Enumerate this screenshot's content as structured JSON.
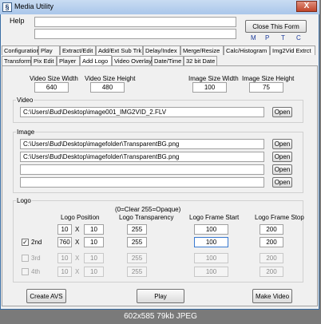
{
  "window": {
    "title": "Media Utility",
    "close_glyph": "X"
  },
  "menu": {
    "help": "Help"
  },
  "top": {
    "close_form": "Close This Form",
    "flags": [
      "M",
      "P",
      "T",
      "C"
    ]
  },
  "tabs_row1": [
    "Configuration",
    "Play",
    "Extract/Edit",
    "Add/Ext Sub Trk",
    "Delay/Index",
    "Merge/Resize",
    "Calc/Histogram",
    "Img2Vid Extrct"
  ],
  "tabs_row2": [
    "Transform",
    "Pix Edit",
    "Player",
    "Add Logo",
    "Video Overlay",
    "Date/Time",
    "32 bit Date"
  ],
  "sizes": {
    "video_width_label": "Video Size Width",
    "video_width": "640",
    "video_height_label": "Video Size Height",
    "video_height": "480",
    "image_width_label": "Image Size Width",
    "image_width": "100",
    "image_height_label": "Image Size Height",
    "image_height": "75"
  },
  "video": {
    "title": "Video",
    "path": "C:\\Users\\Bud\\Desktop\\image001_IMG2VID_2.FLV",
    "open": "Open"
  },
  "image": {
    "title": "Image",
    "paths": [
      "C:\\Users\\Bud\\Desktop\\imagefolder\\TransparentBG.png",
      "C:\\Users\\Bud\\Desktop\\imagefolder\\TransparentBG.png",
      "",
      ""
    ],
    "open": "Open"
  },
  "logo": {
    "title": "Logo",
    "hint": "(0=Clear  255=Opaque)",
    "col_position": "Logo Position",
    "col_transparency": "Logo Transparency",
    "col_start": "Logo Frame Start",
    "col_stop": "Logo Frame Stop",
    "x_sep": "X",
    "rows": [
      {
        "label": "",
        "x": "10",
        "y": "10",
        "transparency": "255",
        "start": "100",
        "stop": "200",
        "checked": false
      },
      {
        "label": "2nd",
        "x": "760",
        "y": "10",
        "transparency": "255",
        "start": "100",
        "stop": "200",
        "checked": true
      },
      {
        "label": "3rd",
        "x": "10",
        "y": "10",
        "transparency": "255",
        "start": "100",
        "stop": "200",
        "checked": false
      },
      {
        "label": "4th",
        "x": "10",
        "y": "10",
        "transparency": "255",
        "start": "100",
        "stop": "200",
        "checked": false
      }
    ]
  },
  "actions": {
    "create_avs": "Create AVS",
    "play": "Play",
    "make_video": "Make Video"
  },
  "status": "602x585  79kb  JPEG"
}
